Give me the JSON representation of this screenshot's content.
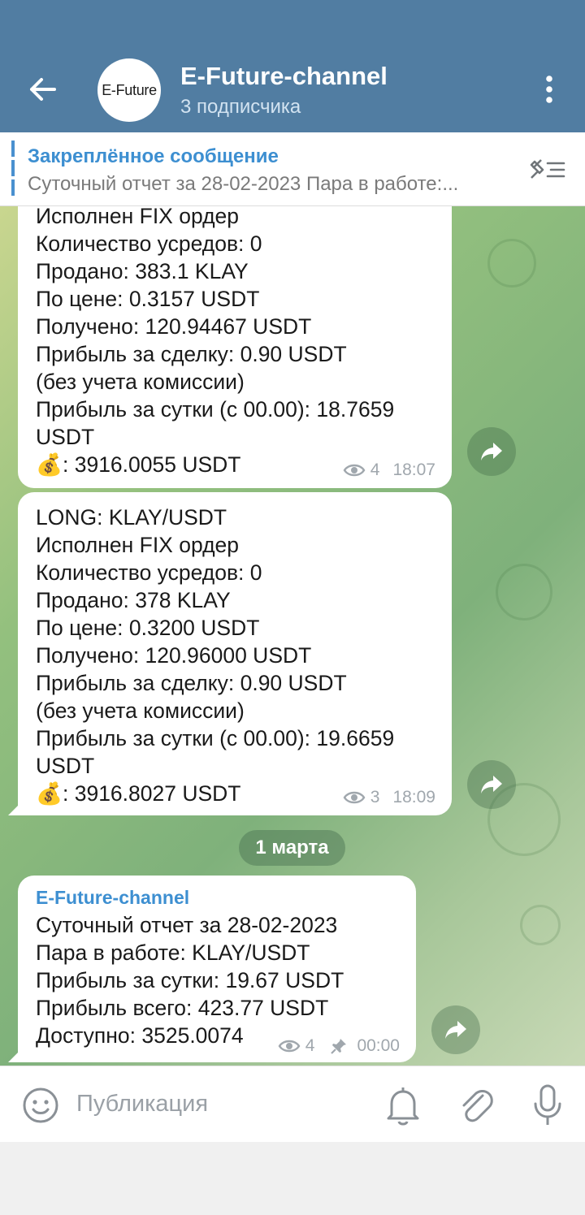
{
  "header": {
    "channel_name": "E-Future-channel",
    "subscribers": "3 подписчика",
    "avatar_text": "E-Future",
    "bg_color": "#517da2"
  },
  "pinned": {
    "title": "Закреплённое сообщение",
    "text": "Суточный отчет за 28-02-2023 Пара в работе:..."
  },
  "messages": [
    {
      "lines": [
        "Исполнен FIX ордер",
        "Количество усредов: 0",
        "Продано: 383.1 KLAY",
        "По цене: 0.3157 USDT",
        "Получено: 120.94467 USDT",
        "Прибыль за сделку: 0.90 USDT",
        "(без учета комиссии)",
        "Прибыль за сутки (с 00.00): 18.7659",
        "USDT",
        "💰: 3916.0055 USDT"
      ],
      "views": "4",
      "time": "18:07"
    },
    {
      "lines": [
        "LONG: KLAY/USDT",
        "Исполнен FIX ордер",
        "Количество усредов: 0",
        "Продано: 378 KLAY",
        "По цене: 0.3200 USDT",
        "Получено: 120.96000 USDT",
        "Прибыль за сделку: 0.90 USDT",
        "(без учета комиссии)",
        "Прибыль за сутки (с 00.00): 19.6659",
        "USDT",
        "💰: 3916.8027 USDT"
      ],
      "views": "3",
      "time": "18:09"
    },
    {
      "sender": "E-Future-channel",
      "lines": [
        "Суточный отчет за 28-02-2023",
        "Пара в работе: KLAY/USDT",
        "Прибыль за сутки: 19.67 USDT",
        "Прибыль всего: 423.77 USDT",
        "Доступно: 3525.0074"
      ],
      "views": "4",
      "time": "00:00"
    }
  ],
  "date_separator": "1 марта",
  "composer": {
    "placeholder": "Публикация"
  },
  "icons": [
    "back-arrow-icon",
    "more-vert-icon",
    "pinned-list-icon",
    "eye-icon",
    "forward-icon",
    "pin-icon",
    "emoji-icon",
    "bell-icon",
    "paperclip-icon",
    "microphone-icon"
  ]
}
